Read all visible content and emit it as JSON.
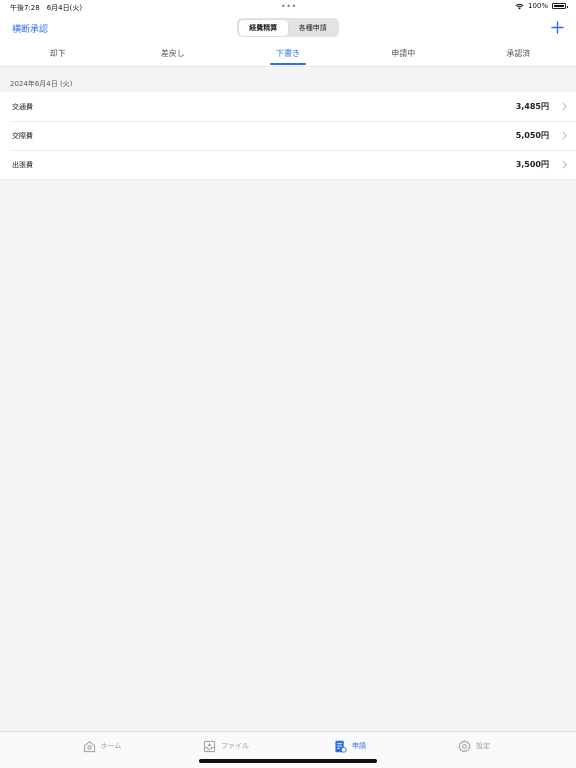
{
  "status": {
    "time_date": "午後7:28　6月4日(火)",
    "dots": "•••",
    "battery": "100%"
  },
  "nav": {
    "left_label": "横断承認",
    "segments": [
      "経費精算",
      "各種申請"
    ],
    "active_segment": 0,
    "add_icon": "plus-icon"
  },
  "tabs": [
    "却下",
    "差戻し",
    "下書き",
    "申請中",
    "承認済"
  ],
  "active_tab": 2,
  "section": {
    "date": "2024年6月4日 (火)"
  },
  "items": [
    {
      "title": "交通費",
      "amount": "3,485円"
    },
    {
      "title": "交際費",
      "amount": "5,050円"
    },
    {
      "title": "出張費",
      "amount": "3,500円"
    }
  ],
  "tabbar": [
    {
      "label": "ホーム",
      "icon": "home-icon"
    },
    {
      "label": "ファイル",
      "icon": "tray-icon"
    },
    {
      "label": "申請",
      "icon": "document-icon"
    },
    {
      "label": "設定",
      "icon": "gear-icon"
    }
  ],
  "active_tabbar": 2,
  "colors": {
    "accent": "#2f6fe5",
    "background": "#f5f4f5",
    "inactive": "#9a9a9e"
  }
}
